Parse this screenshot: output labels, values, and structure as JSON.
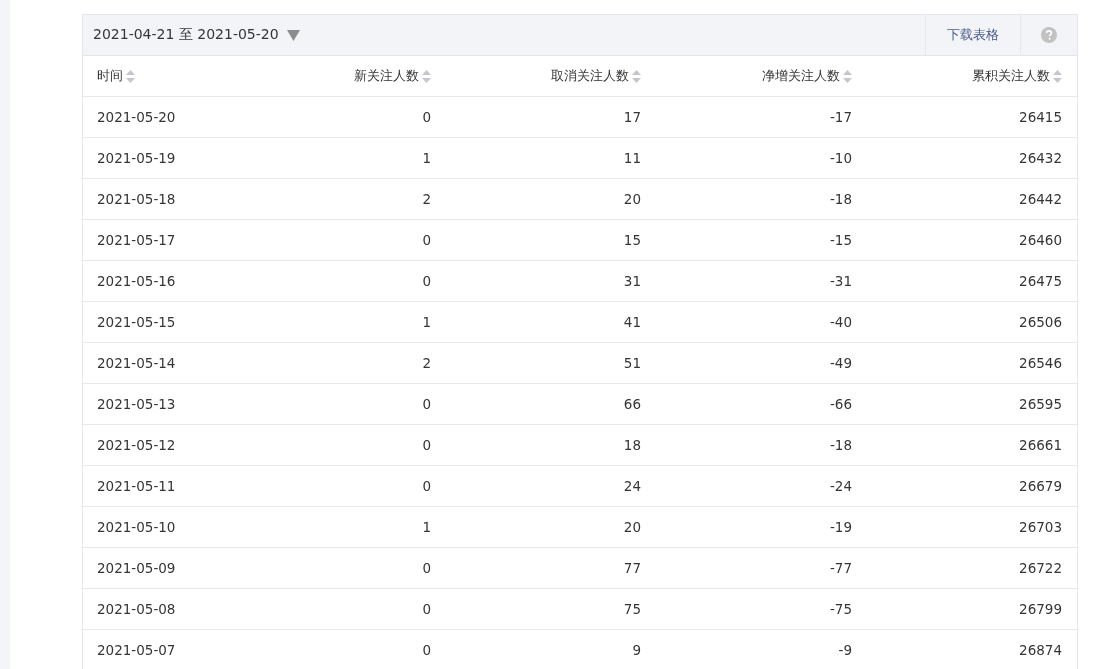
{
  "toolbar": {
    "date_range": "2021-04-21 至 2021-05-20",
    "download_button": "下载表格"
  },
  "table": {
    "columns": [
      {
        "label": "时间"
      },
      {
        "label": "新关注人数"
      },
      {
        "label": "取消关注人数"
      },
      {
        "label": "净增关注人数"
      },
      {
        "label": "累积关注人数"
      }
    ],
    "rows": [
      [
        "2021-05-20",
        "0",
        "17",
        "-17",
        "26415"
      ],
      [
        "2021-05-19",
        "1",
        "11",
        "-10",
        "26432"
      ],
      [
        "2021-05-18",
        "2",
        "20",
        "-18",
        "26442"
      ],
      [
        "2021-05-17",
        "0",
        "15",
        "-15",
        "26460"
      ],
      [
        "2021-05-16",
        "0",
        "31",
        "-31",
        "26475"
      ],
      [
        "2021-05-15",
        "1",
        "41",
        "-40",
        "26506"
      ],
      [
        "2021-05-14",
        "2",
        "51",
        "-49",
        "26546"
      ],
      [
        "2021-05-13",
        "0",
        "66",
        "-66",
        "26595"
      ],
      [
        "2021-05-12",
        "0",
        "18",
        "-18",
        "26661"
      ],
      [
        "2021-05-11",
        "0",
        "24",
        "-24",
        "26679"
      ],
      [
        "2021-05-10",
        "1",
        "20",
        "-19",
        "26703"
      ],
      [
        "2021-05-09",
        "0",
        "77",
        "-77",
        "26722"
      ],
      [
        "2021-05-08",
        "0",
        "75",
        "-75",
        "26799"
      ],
      [
        "2021-05-07",
        "0",
        "9",
        "-9",
        "26874"
      ]
    ]
  }
}
